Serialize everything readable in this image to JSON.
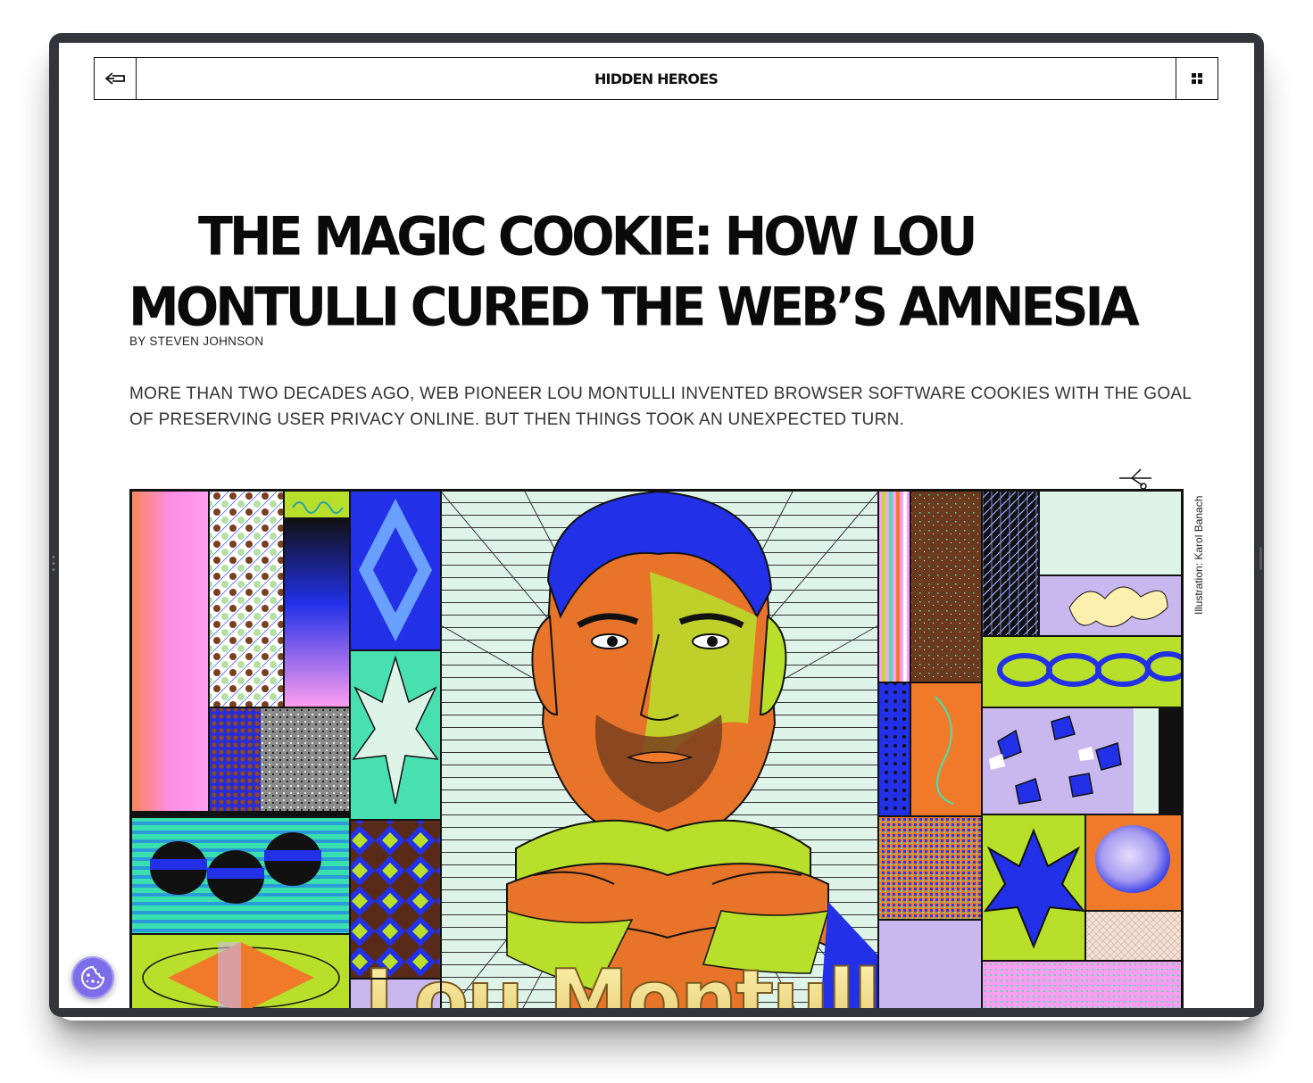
{
  "nav": {
    "title": "HIDDEN HEROES",
    "back_icon": "arrow-left-icon",
    "menu_icon": "grid-icon"
  },
  "article": {
    "headline": "THE MAGIC COOKIE: HOW LOU MONTULLI CURED THE WEB’S AMNESIA",
    "byline": "BY STEVEN JOHNSON",
    "dek": "MORE THAN TWO DECADES AGO, WEB PIONEER LOU MONTULLI INVENTED BROWSER SOFTWARE COOKIES WITH THE GOAL OF PRESERVING USER PRIVACY ONLINE. BUT THEN THINGS TOOK AN UNEXPECTED TURN.",
    "illustration_credit": "Illustration: Karol Banach",
    "illustration_lettering": "Lou Montulli"
  },
  "cookie_consent": {
    "icon": "cookie-icon",
    "color": "#7b6ee8"
  },
  "colors": {
    "ink": "#0a0a0a",
    "frame": "#34343c",
    "background": "#ffffff"
  }
}
